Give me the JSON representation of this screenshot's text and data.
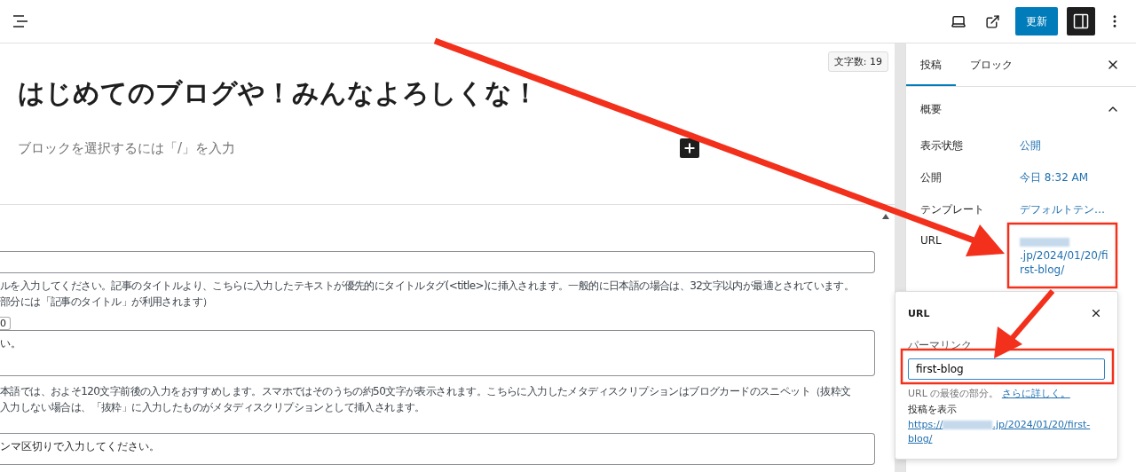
{
  "toolbar": {
    "update_button": "更新",
    "settings_toggle": {
      "selected": true
    }
  },
  "editor": {
    "word_count": "文字数: 19",
    "title": "はじめてのブログや！みんなよろしくな！",
    "placeholder": "ブロックを選択するには「/」を入力",
    "meta": {
      "help_1": [
        "ルを入力してください。記事のタイトルより、こちらに入力したテキストが優先的にタイトルタグ(<title>)に挿入されます。一般的に日本語の場合は、32文字以内が最適とされています。",
        "部分には「記事のタイトル」が利用されます）"
      ],
      "counter": "0",
      "description_value": "い。",
      "help_2": [
        "本語では、およそ120文字前後の入力をおすすめします。スマホではそのうちの約50文字が表示されます。こちらに入力したメタディスクリプションはブログカードのスニペット（抜粋文",
        "入力しない場合は、「抜粋」に入力したものがメタディスクリプションとして挿入されます。"
      ],
      "keywords_value": "ンマ区切りで入力してください。"
    }
  },
  "sidebar": {
    "tabs": [
      {
        "label": "投稿",
        "selected": true
      },
      {
        "label": "ブロック",
        "selected": false
      }
    ],
    "section": {
      "title": "概要",
      "expanded": true
    },
    "rows": [
      {
        "label": "表示状態",
        "value": "公開"
      },
      {
        "label": "公開",
        "value": "今日 8:32 AM"
      },
      {
        "label": "テンプレート",
        "value": "デフォルトテン…"
      },
      {
        "label": "URL",
        "value": ".jp/2024/01/20/first-blog/"
      }
    ]
  },
  "popover": {
    "title": "URL",
    "field_label": "パーマリンク",
    "value": "first-blog",
    "help": "URL の最後の部分。",
    "help_link": "さらに詳しく。",
    "view_label": "投稿を表示",
    "link": "https://",
    "link_rest": ".jp/2024/01/20/first-blog/"
  }
}
